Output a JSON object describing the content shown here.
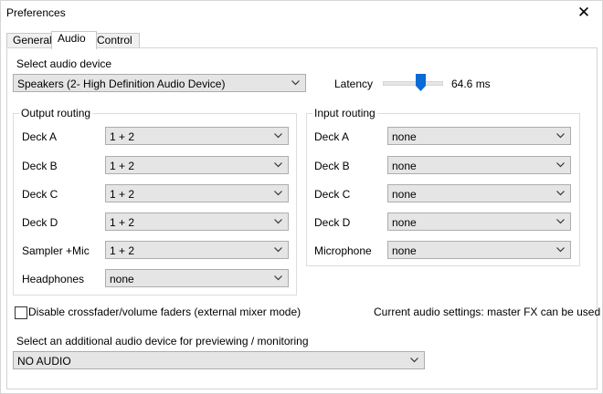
{
  "window": {
    "title": "Preferences"
  },
  "tabs": [
    {
      "label": "General"
    },
    {
      "label": "Audio"
    },
    {
      "label": "Control"
    }
  ],
  "audio_device": {
    "label": "Select audio device",
    "value": "Speakers (2- High Definition Audio Device)"
  },
  "latency": {
    "label": "Latency",
    "value": "64.6 ms",
    "level": 0.65
  },
  "output_routing": {
    "title": "Output routing",
    "rows": [
      {
        "label": "Deck A",
        "value": "1 + 2"
      },
      {
        "label": "Deck B",
        "value": "1 + 2"
      },
      {
        "label": "Deck C",
        "value": "1 + 2"
      },
      {
        "label": "Deck D",
        "value": "1 + 2"
      },
      {
        "label": "Sampler +Mic",
        "value": "1 + 2"
      },
      {
        "label": "Headphones",
        "value": "none"
      }
    ]
  },
  "input_routing": {
    "title": "Input routing",
    "rows": [
      {
        "label": "Deck A",
        "value": "none"
      },
      {
        "label": "Deck B",
        "value": "none"
      },
      {
        "label": "Deck C",
        "value": "none"
      },
      {
        "label": "Deck D",
        "value": "none"
      },
      {
        "label": "Microphone",
        "value": "none"
      }
    ]
  },
  "disable_crossfader": {
    "label": "Disable crossfader/volume faders (external mixer mode)",
    "checked": false
  },
  "status_text": "Current audio settings: master FX can be used",
  "monitor_device": {
    "label": "Select an additional audio device for previewing / monitoring",
    "value": "NO AUDIO"
  },
  "colors": {
    "slider_thumb": "#0a6ad6",
    "window_bg": "#f0f0f0"
  }
}
